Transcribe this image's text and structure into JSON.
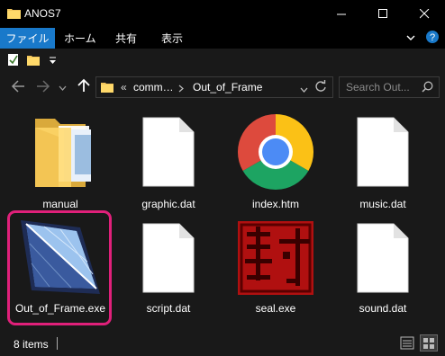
{
  "window": {
    "title": "ANOS7"
  },
  "ribbon": {
    "tabs": [
      "ファイル",
      "ホーム",
      "共有",
      "表示"
    ]
  },
  "address": {
    "overflow": "«",
    "segments": [
      "comm…",
      "Out_of_Frame"
    ]
  },
  "search": {
    "placeholder": "Search Out..."
  },
  "files": [
    {
      "name": "manual",
      "icon": "folder-icon"
    },
    {
      "name": "graphic.dat",
      "icon": "document-icon"
    },
    {
      "name": "index.htm",
      "icon": "chrome-icon"
    },
    {
      "name": "music.dat",
      "icon": "document-icon"
    },
    {
      "name": "Out_of_Frame.exe",
      "icon": "crystal-icon"
    },
    {
      "name": "script.dat",
      "icon": "document-icon"
    },
    {
      "name": "seal.exe",
      "icon": "seal-icon"
    },
    {
      "name": "sound.dat",
      "icon": "document-icon"
    }
  ],
  "status": {
    "item_count": "8 items"
  },
  "colors": {
    "accent": "#1979ca",
    "highlight": "#e0207a",
    "background": "#191919"
  }
}
